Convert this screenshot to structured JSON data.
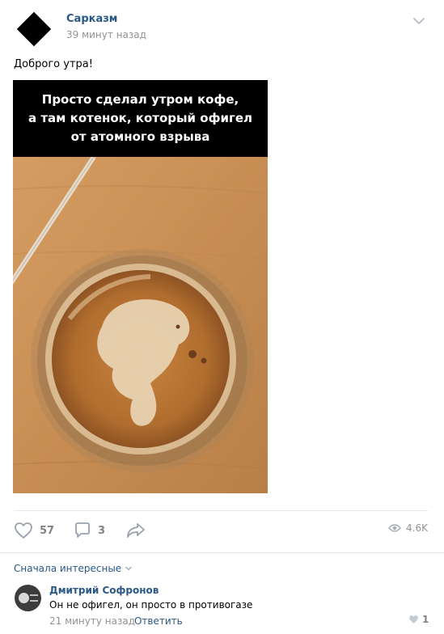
{
  "post": {
    "author": "Сарказм",
    "time": "39 минут назад",
    "text": "Доброго утра!",
    "image_caption": [
      "Просто сделал утром кофе,",
      "а там котенок, который офигел",
      "от атомного взрыва"
    ],
    "likes": "57",
    "comments": "3",
    "views": "4.6K"
  },
  "comments_section": {
    "sort_label": "Сначала интересные",
    "items": [
      {
        "author": "Дмитрий Софронов",
        "text": "Он не офигел, он просто в противогазе",
        "time": "21 минуту назад",
        "reply_label": "Ответить",
        "likes": "1"
      }
    ]
  },
  "colors": {
    "link": "#2a5885",
    "muted": "#939393",
    "icon": "#99a2ad"
  },
  "icons": [
    "chevron-down-icon",
    "heart-icon",
    "comment-icon",
    "share-icon",
    "eye-icon"
  ]
}
